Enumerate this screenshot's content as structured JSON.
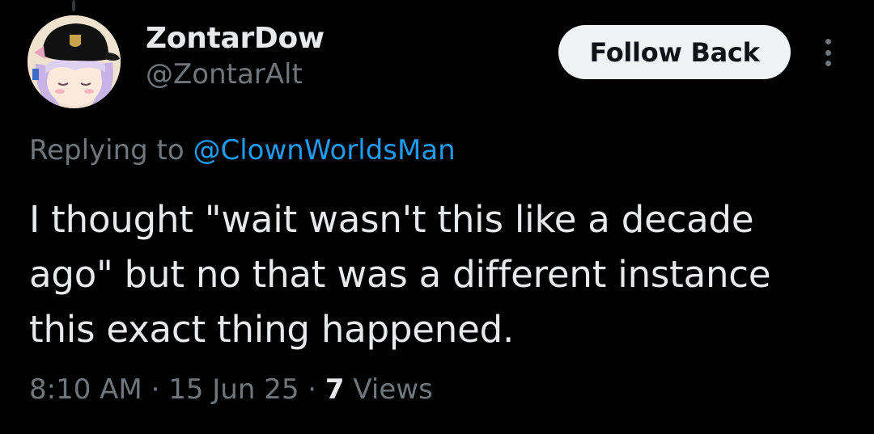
{
  "author": {
    "display_name": "ZontarDow",
    "handle": "@ZontarAlt"
  },
  "actions": {
    "follow_label": "Follow Back",
    "more_icon": "more-vertical-icon"
  },
  "reply": {
    "prefix": "Replying to ",
    "mention": "@ClownWorldsMan"
  },
  "tweet": {
    "text": "I thought \"wait wasn't this like a decade ago\" but no that was a different instance this exact thing happened."
  },
  "meta": {
    "time": "8:10 AM",
    "separator": "·",
    "date": "15 Jun 25",
    "views_count": "7",
    "views_label": "Views"
  },
  "colors": {
    "background": "#000000",
    "primary_text": "#e7e9ea",
    "secondary_text": "#71767b",
    "link": "#1d9bf0",
    "button_bg": "#eff3f4",
    "button_text": "#0f1419"
  }
}
